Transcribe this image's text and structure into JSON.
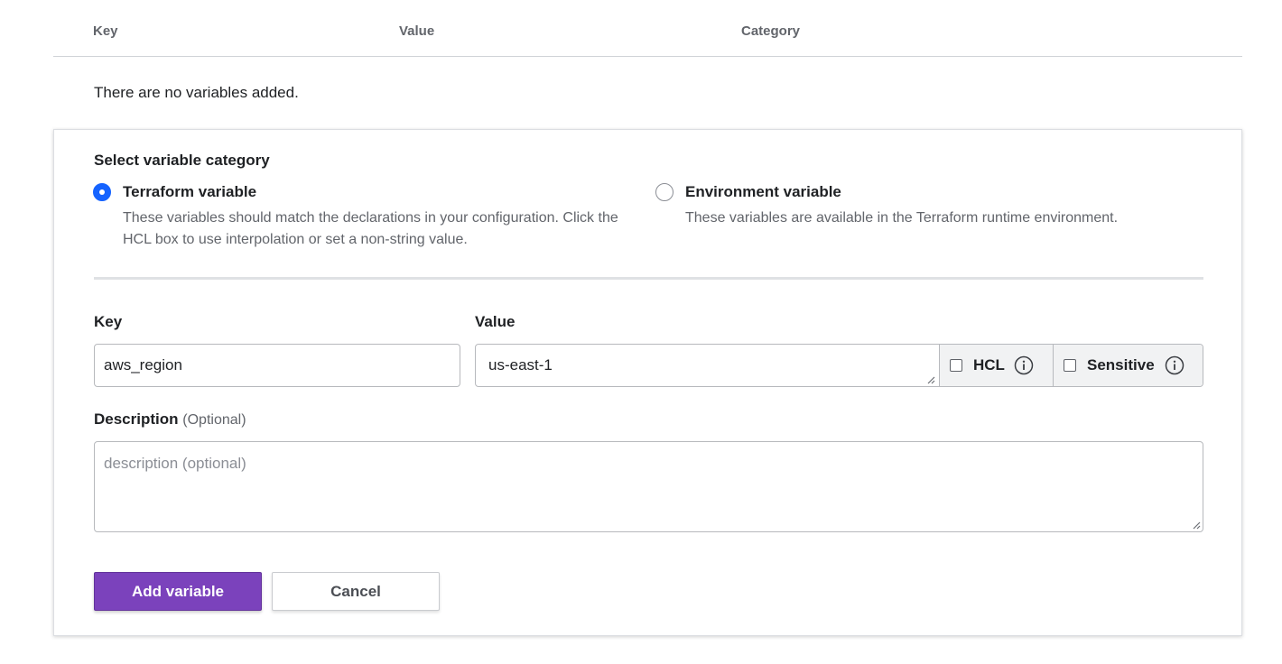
{
  "table": {
    "columns": [
      "Key",
      "Value",
      "Category"
    ],
    "empty_message": "There are no variables added."
  },
  "form": {
    "category_title": "Select variable category",
    "categories": [
      {
        "label": "Terraform variable",
        "description": "These variables should match the declarations in your configuration. Click the HCL box to use interpolation or set a non-string value.",
        "selected": true
      },
      {
        "label": "Environment variable",
        "description": "These variables are available in the Terraform runtime environment.",
        "selected": false
      }
    ],
    "key_label": "Key",
    "key_value": "aws_region",
    "value_label": "Value",
    "value_value": "us-east-1",
    "hcl_label": "HCL",
    "hcl_checked": false,
    "sensitive_label": "Sensitive",
    "sensitive_checked": false,
    "description_label": "Description",
    "description_optional": "(Optional)",
    "description_placeholder": "description (optional)",
    "add_button": "Add variable",
    "cancel_button": "Cancel"
  },
  "colors": {
    "primary_button": "#7b42bc",
    "radio_selected": "#1563ff",
    "muted_text": "#62656b"
  },
  "icons": {
    "info": "info-circle-icon",
    "resize": "resize-grip-icon"
  }
}
